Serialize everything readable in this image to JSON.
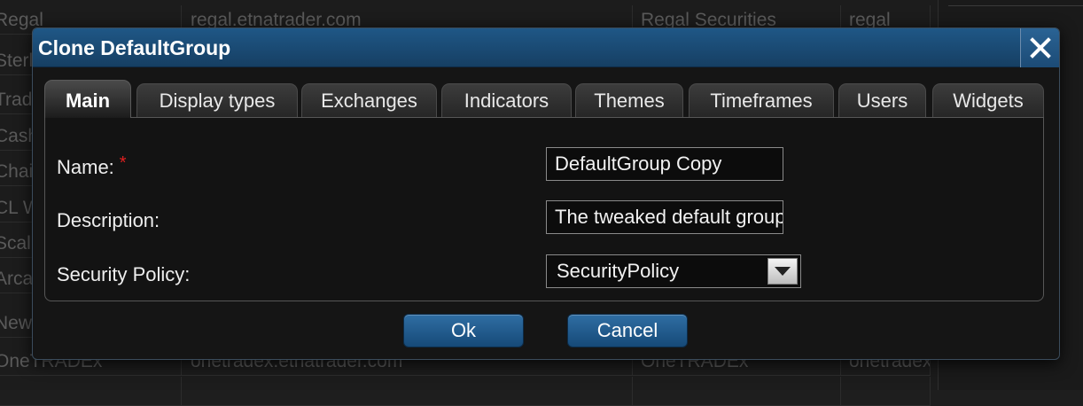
{
  "background_table": {
    "rows": [
      {
        "c1": "Regal",
        "c2": "regal.etnatrader.com",
        "c3": "Regal Securities",
        "c4": "regal"
      },
      {
        "c1": "Sterling",
        "c2": "",
        "c3": "",
        "c4": ""
      },
      {
        "c1": "Trade",
        "c2": "",
        "c3": "",
        "c4": ""
      },
      {
        "c1": "Cashier",
        "c2": "",
        "c3": "",
        "c4": ""
      },
      {
        "c1": "Chaive",
        "c2": "",
        "c3": "",
        "c4": ""
      },
      {
        "c1": "CL W",
        "c2": "",
        "c3": "",
        "c4": ""
      },
      {
        "c1": "ScalpT",
        "c2": "",
        "c3": "",
        "c4": ""
      },
      {
        "c1": "Arca T",
        "c2": "",
        "c3": "",
        "c4": ""
      },
      {
        "c1": "New A",
        "c2": "",
        "c3": "",
        "c4": ""
      },
      {
        "c1": "OneTRADEx",
        "c2": "onetradex.etnatrader.com",
        "c3": "OneTRADEx",
        "c4": "onetradex"
      },
      {
        "c1": "",
        "c2": "",
        "c3": "",
        "c4": ""
      }
    ]
  },
  "dialog": {
    "title": "Clone DefaultGroup",
    "close_icon": "close-icon",
    "tabs": [
      {
        "label": "Main",
        "active": true
      },
      {
        "label": "Display types",
        "active": false
      },
      {
        "label": "Exchanges",
        "active": false
      },
      {
        "label": "Indicators",
        "active": false
      },
      {
        "label": "Themes",
        "active": false
      },
      {
        "label": "Timeframes",
        "active": false
      },
      {
        "label": "Users",
        "active": false
      },
      {
        "label": "Widgets",
        "active": false
      }
    ],
    "form": {
      "name_label": "Name:",
      "required_marker": "*",
      "name_value": "DefaultGroup Copy",
      "description_label": "Description:",
      "description_value": "The tweaked default group",
      "security_label": "Security Policy:",
      "security_value": "SecurityPolicy"
    },
    "buttons": {
      "ok": "Ok",
      "cancel": "Cancel"
    }
  },
  "colors": {
    "titlebar": "#1f5786",
    "button": "#1f5a8c",
    "required": "#e02020"
  }
}
